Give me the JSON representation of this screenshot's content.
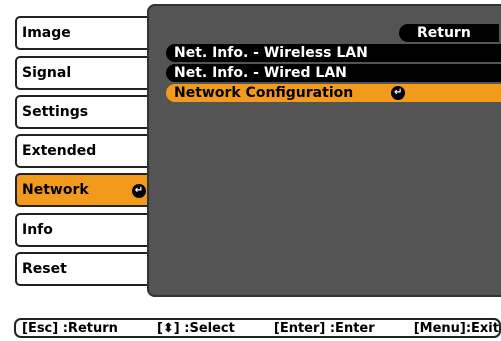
{
  "left_menu": {
    "items": [
      {
        "label": "Image"
      },
      {
        "label": "Signal"
      },
      {
        "label": "Settings"
      },
      {
        "label": "Extended"
      },
      {
        "label": "Network",
        "active": true,
        "enter_symbol": "↵"
      },
      {
        "label": "Info"
      },
      {
        "label": "Reset"
      }
    ]
  },
  "panel": {
    "return_label": "Return",
    "items": [
      {
        "label": "Net. Info. - Wireless LAN"
      },
      {
        "label": "Net. Info. - Wired LAN"
      },
      {
        "label": "Network Configuration",
        "active": true,
        "enter_symbol": "↵"
      }
    ]
  },
  "help_bar": {
    "esc": "[Esc] :Return",
    "select": "[⬍] :Select",
    "enter": "[Enter] :Enter",
    "menu": "[Menu]:Exit"
  },
  "colors": {
    "accent": "#f29a1c",
    "panel_bg": "#545454",
    "item_bg": "#000000"
  }
}
